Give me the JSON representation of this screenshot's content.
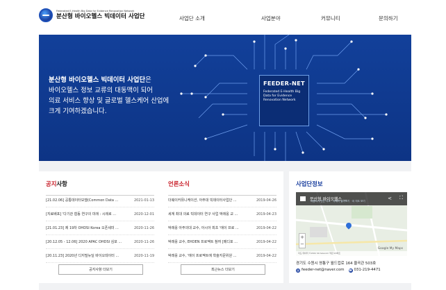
{
  "header": {
    "logo_sub": "Federated E-Health Big Data for Evidence Renovation Network",
    "logo_main": "분산형 바이오헬스 빅데이터 사업단",
    "nav": [
      "사업단 소개",
      "사업분야",
      "커뮤니티",
      "문의하기"
    ]
  },
  "hero": {
    "line1_strong": "분산형 바이오헬스 빅데이터 사업단",
    "line1_rest": "은",
    "line2": "바이오헬스 정보 교류의 대동맥이 되어",
    "line3": "의료 서비스 향상 및 글로벌 헬스케어 산업에",
    "line4": "크게 기여하겠습니다.",
    "badge_title": "FEEDER-NET",
    "badge_desc": "Federated E-Health Big Data for Evidence Renovation Network"
  },
  "notice": {
    "title_a": "공지",
    "title_b": "사항",
    "items": [
      {
        "title": "[21.02.06] 공통데이터모델(Common Data ...",
        "date": "2021-01-13"
      },
      {
        "title": "[지료배포] '다기관 협동 연구의 미래 : 시레로 ...",
        "date": "2020-12-01"
      },
      {
        "title": "[21.01.23] 제 19차 OHDSI Korea 오픈세미 ...",
        "date": "2020-11-26"
      },
      {
        "title": "[20.12.05 - 12.06] 2020 APAC OHDSI 심포 ...",
        "date": "2020-11-26"
      },
      {
        "title": "[20.11.23] 2020년 디지털뉴딜 바이오데이터 ...",
        "date": "2020-11-19"
      }
    ],
    "more_label": "공지사항 더보기"
  },
  "press": {
    "title": "언론소식",
    "items": [
      {
        "title": "더웨이커뮤니케이션, 아주대 빅데이터사업단 ...",
        "date": "2019-04-26"
      },
      {
        "title": "세계 최대 의료 빅데이터 연구 사업 박래웅 교 ...",
        "date": "2019-04-23"
      },
      {
        "title": "박래웅 아주의대 교수, 아시아 최초 '에이 프로 ...",
        "date": "2019-04-22"
      },
      {
        "title": "박래웅 교수, EHDEN 프로젝트 참여 [메디포 ...",
        "date": "2019-04-22"
      },
      {
        "title": "박래웅 교수, '에이 프로젝트에 학술지문위원 ...",
        "date": "2019-04-22"
      }
    ],
    "more_label": "최근뉴스 더보기"
  },
  "info": {
    "title": "사업단정보",
    "map_title": "분산형 바이오헬스 ...",
    "map_sub": "사용자가 만든 지도 · 자세히 알아보기 · 이 지도 보기",
    "map_brand": "Google My Maps",
    "map_foot": "지도 데이터 ©2021 SK telecom  약관  20피트",
    "address": "경기도 수원시 영통구 월드컵로 164 율곡관 503호",
    "email": "feeder-net@naver.com",
    "phone": "031-219-4471"
  }
}
